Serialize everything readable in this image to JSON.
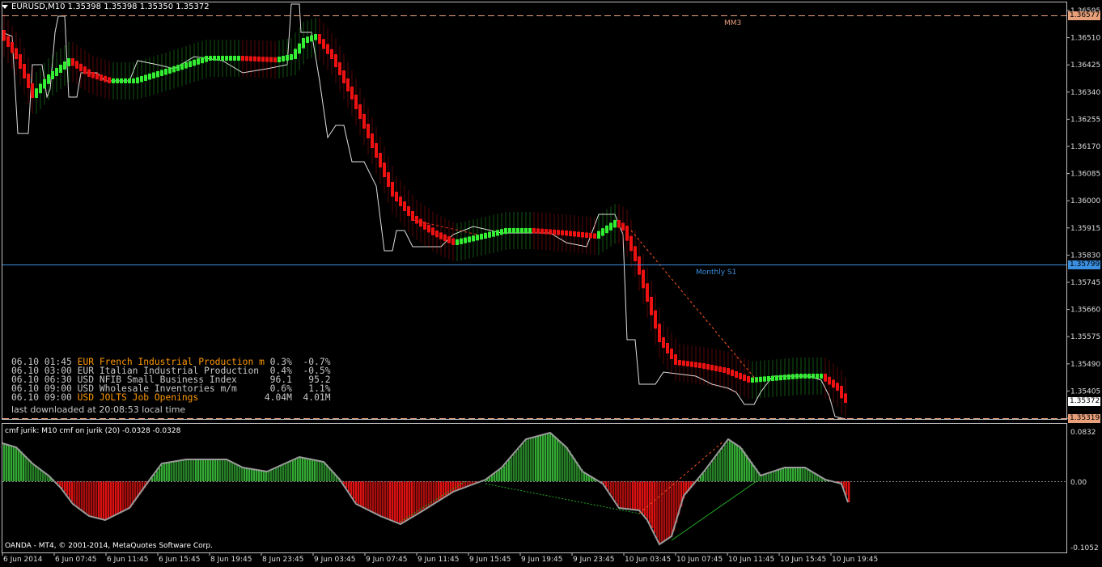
{
  "window": {
    "symbol_line": "EURUSD,M10  1.35398 1.35398 1.35350 1.35372"
  },
  "main_axis": {
    "ticks": [
      "1.36595",
      "1.36510",
      "1.36425",
      "1.36340",
      "1.36255",
      "1.36170",
      "1.36085",
      "1.36000",
      "1.35915",
      "1.35830",
      "1.35745",
      "1.35660",
      "1.35575",
      "1.35490",
      "1.35405",
      "1.35320"
    ],
    "current_price": "1.35372",
    "mm3_price": "1.36577",
    "monthly_s1_price": "1.35799",
    "bottom_level_price": "1.35319"
  },
  "levels": {
    "mm3_label": "MM3",
    "monthly_s1_label": "Monthly S1",
    "mm3_color": "#e8a07a",
    "s1_color": "#3a8fe0"
  },
  "news": {
    "rows": [
      {
        "time": "06.10 01:45",
        "cur": "EUR",
        "event": "French Industrial Production m",
        "actual": "0.3%",
        "prev": "-0.7%",
        "highlight": true
      },
      {
        "time": "06.10 03:00",
        "cur": "EUR",
        "event": "Italian Industrial Production",
        "actual": "0.4%",
        "prev": "-0.5%",
        "highlight": false
      },
      {
        "time": "06.10 06:30",
        "cur": "USD",
        "event": "NFIB Small Business Index",
        "actual": "96.1",
        "prev": "95.2",
        "highlight": false
      },
      {
        "time": "06.10 09:00",
        "cur": "USD",
        "event": "Wholesale Inventories m/m",
        "actual": "0.6%",
        "prev": "1.1%",
        "highlight": false
      },
      {
        "time": "06.10 09:00",
        "cur": "USD",
        "event": "JOLTS Job Openings",
        "actual": "4.04M",
        "prev": "4.01M",
        "highlight": true
      }
    ],
    "last_downloaded": "last downloaded at 20:08:53 local time"
  },
  "sub_window": {
    "title": "cmf jurik: M10   cmf on jurik (20) -0.0328 -0.0328",
    "ticks": [
      "0.0832",
      "0.00",
      "-0.1052"
    ],
    "broker": "OANDA - MT4, © 2001-2014, MetaQuotes Software Corp."
  },
  "time_axis": {
    "labels": [
      "6 Jun 2014",
      "6 Jun 07:45",
      "6 Jun 11:45",
      "6 Jun 15:45",
      "8 Jun 19:45",
      "8 Jun 23:45",
      "9 Jun 03:45",
      "9 Jun 07:45",
      "9 Jun 11:45",
      "9 Jun 15:45",
      "9 Jun 19:45",
      "9 Jun 23:45",
      "10 Jun 03:45",
      "10 Jun 07:45",
      "10 Jun 11:45",
      "10 Jun 15:45",
      "10 Jun 19:45"
    ]
  },
  "colors": {
    "bull": "#33ee33",
    "bear": "#ee1111",
    "cmf_up": "#33aa33",
    "cmf_down": "#dd1111"
  }
}
